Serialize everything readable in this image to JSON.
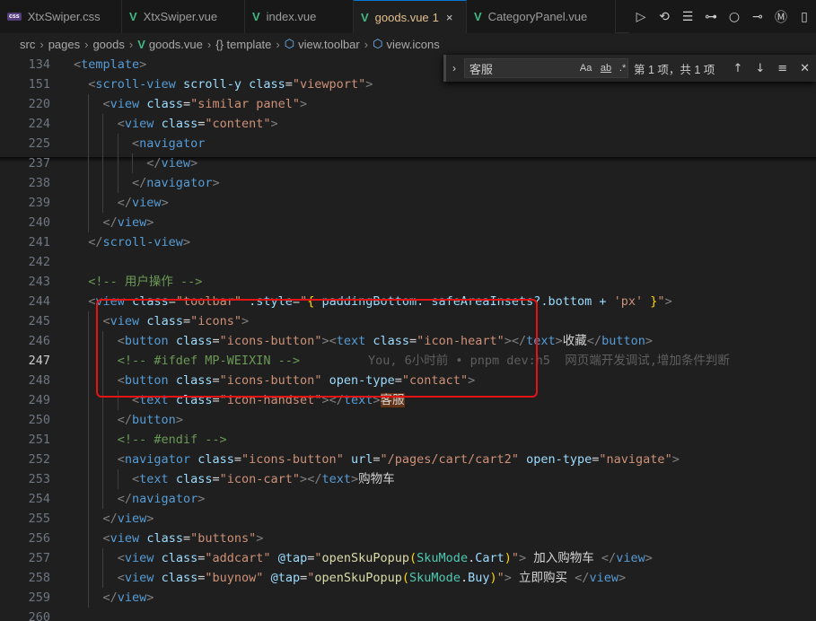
{
  "tabs": [
    {
      "label": "XtxSwiper.css",
      "type": "css",
      "active": false
    },
    {
      "label": "XtxSwiper.vue",
      "type": "vue",
      "active": false
    },
    {
      "label": "index.vue",
      "type": "vue",
      "active": false
    },
    {
      "label": "goods.vue",
      "type": "vue",
      "active": true,
      "badge": "1"
    },
    {
      "label": "CategoryPanel.vue",
      "type": "vue",
      "active": false
    }
  ],
  "tab_close_icon": "×",
  "tab_actions": [
    "▷",
    "⟲",
    "☰",
    "⊶",
    "○",
    "⊸",
    "Ⓜ",
    "▯"
  ],
  "breadcrumb": [
    "src",
    "pages",
    "goods",
    "goods.vue",
    "{} template",
    "view.toolbar",
    "view.icons"
  ],
  "find": {
    "query": "客服",
    "match_case": "Aa",
    "whole_word": "ab",
    "regex": ".*",
    "result": "第 1 项，共 1 项"
  },
  "lines": [
    {
      "n": "134",
      "code": "<template>"
    },
    {
      "n": "151",
      "code": "  <scroll-view scroll-y class=\"viewport\">"
    },
    {
      "n": "220",
      "code": "    <view class=\"similar panel\">"
    },
    {
      "n": "224",
      "code": "      <view class=\"content\">"
    },
    {
      "n": "225",
      "code": "        <navigator"
    },
    {
      "n": "237",
      "code": "          </view>"
    },
    {
      "n": "238",
      "code": "        </navigator>"
    },
    {
      "n": "239",
      "code": "      </view>"
    },
    {
      "n": "240",
      "code": "    </view>"
    },
    {
      "n": "241",
      "code": "  </scroll-view>"
    },
    {
      "n": "242",
      "code": ""
    },
    {
      "n": "243",
      "code": "  <!-- 用户操作 -->"
    },
    {
      "n": "244",
      "code": "  <view class=\"toolbar\" :style=\"{ paddingBottom: safeAreaInsets?.bottom + 'px' }\">"
    },
    {
      "n": "245",
      "code": "    <view class=\"icons\">"
    },
    {
      "n": "246",
      "code": "      <button class=\"icons-button\"><text class=\"icon-heart\"></text>收藏</button>"
    },
    {
      "n": "247",
      "code": "      <!-- #ifdef MP-WEIXIN -->",
      "blame": "You, 6小时前 • pnpm dev:h5  网页端开发调试,增加条件判断"
    },
    {
      "n": "248",
      "code": "      <button class=\"icons-button\" open-type=\"contact\">"
    },
    {
      "n": "249",
      "code": "        <text class=\"icon-handset\"></text>客服"
    },
    {
      "n": "250",
      "code": "      </button>"
    },
    {
      "n": "251",
      "code": "      <!-- #endif -->"
    },
    {
      "n": "252",
      "code": "      <navigator class=\"icons-button\" url=\"/pages/cart/cart2\" open-type=\"navigate\">"
    },
    {
      "n": "253",
      "code": "        <text class=\"icon-cart\"></text>购物车"
    },
    {
      "n": "254",
      "code": "      </navigator>"
    },
    {
      "n": "255",
      "code": "    </view>"
    },
    {
      "n": "256",
      "code": "    <view class=\"buttons\">"
    },
    {
      "n": "257",
      "code": "      <view class=\"addcart\" @tap=\"openSkuPopup(SkuMode.Cart)\"> 加入购物车 </view>"
    },
    {
      "n": "258",
      "code": "      <view class=\"buynow\" @tap=\"openSkuPopup(SkuMode.Buy)\"> 立即购买 </view>"
    },
    {
      "n": "259",
      "code": "    </view>"
    },
    {
      "n": "260",
      "code": ""
    }
  ],
  "active_line": "247",
  "highlight_term": "客服",
  "colors": {
    "annotation": "#e51414",
    "active_tab_accent": "#0078d4",
    "vue": "#41b883"
  }
}
